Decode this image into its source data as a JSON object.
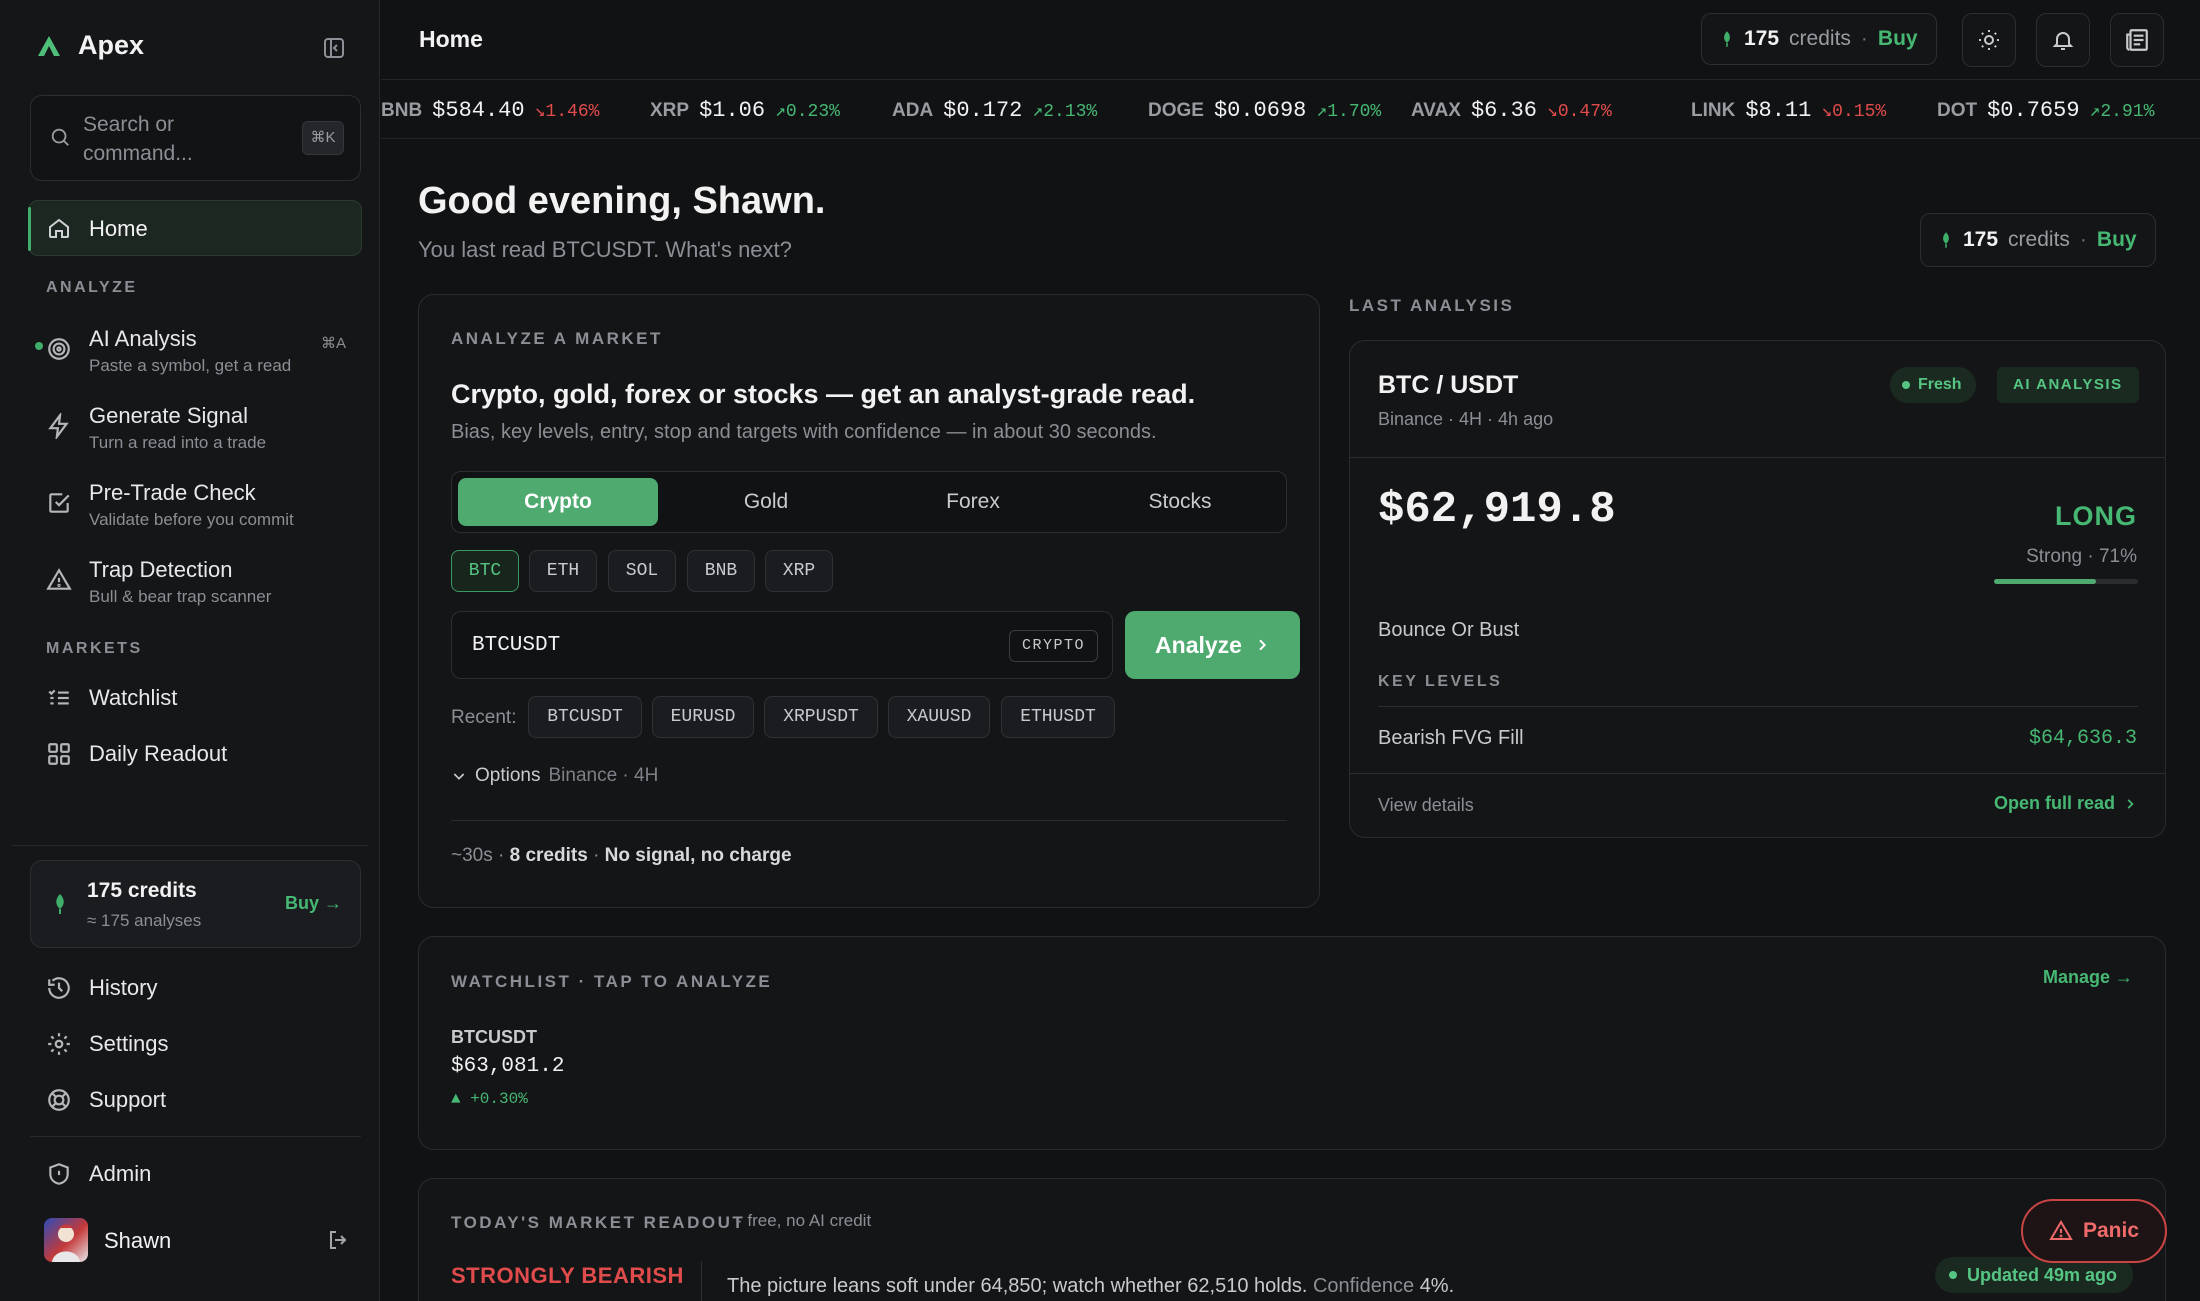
{
  "app": {
    "name": "Apex"
  },
  "search": {
    "placeholder": "Search or command...",
    "shortcut": "⌘K"
  },
  "sidebar": {
    "home_label": "Home",
    "analyze_section": "ANALYZE",
    "analyze_items": [
      {
        "title": "AI Analysis",
        "sub": "Paste a symbol, get a read",
        "shortcut": "⌘A"
      },
      {
        "title": "Generate Signal",
        "sub": "Turn a read into a trade"
      },
      {
        "title": "Pre-Trade Check",
        "sub": "Validate before you commit"
      },
      {
        "title": "Trap Detection",
        "sub": "Bull & bear trap scanner"
      }
    ],
    "markets_section": "MARKETS",
    "market_items": [
      "Watchlist",
      "Daily Readout"
    ],
    "credits": {
      "title": "175 credits",
      "sub": "≈ 175 analyses",
      "buy": "Buy →"
    },
    "footer_items": [
      "History",
      "Settings",
      "Support"
    ],
    "admin": "Admin",
    "user": {
      "name": "Shawn"
    }
  },
  "topbar": {
    "title": "Home",
    "credits": {
      "count": "175",
      "word": "credits",
      "sep": "·",
      "buy": "Buy"
    }
  },
  "ticker": [
    {
      "sym": "BNB",
      "price": "$584.40",
      "chg": "↘1.46%",
      "dir": "down"
    },
    {
      "sym": "XRP",
      "price": "$1.06",
      "chg": "↗0.23%",
      "dir": "up"
    },
    {
      "sym": "ADA",
      "price": "$0.172",
      "chg": "↗2.13%",
      "dir": "up"
    },
    {
      "sym": "DOGE",
      "price": "$0.0698",
      "chg": "↗1.70%",
      "dir": "up"
    },
    {
      "sym": "AVAX",
      "price": "$6.36",
      "chg": "↘0.47%",
      "dir": "down"
    },
    {
      "sym": "LINK",
      "price": "$8.11",
      "chg": "↘0.15%",
      "dir": "down"
    },
    {
      "sym": "DOT",
      "price": "$0.7659",
      "chg": "↗2.91%",
      "dir": "up"
    }
  ],
  "greeting": {
    "title": "Good evening, Shawn.",
    "sub": "You last read BTCUSDT. What's next?"
  },
  "analyze": {
    "label": "ANALYZE A MARKET",
    "headline": "Crypto, gold, forex or stocks — get an analyst-grade read.",
    "desc": "Bias, key levels, entry, stop and targets with confidence — in about 30 seconds.",
    "tabs": [
      "Crypto",
      "Gold",
      "Forex",
      "Stocks"
    ],
    "quick": [
      "BTC",
      "ETH",
      "SOL",
      "BNB",
      "XRP"
    ],
    "input_value": "BTCUSDT",
    "input_tag": "CRYPTO",
    "button": "Analyze",
    "recent_label": "Recent:",
    "recent": [
      "BTCUSDT",
      "EURUSD",
      "XRPUSDT",
      "XAUUSD",
      "ETHUSDT"
    ],
    "options_label": "Options",
    "options_meta": "Binance · 4H",
    "foot_time": "~30s ·",
    "foot_credits": "8 credits",
    "foot_sep": "·",
    "foot_charge": "No signal, no charge"
  },
  "last_analysis": {
    "label": "LAST ANALYSIS",
    "pair": "BTC / USDT",
    "meta": "Binance · 4H · 4h ago",
    "fresh": "Fresh",
    "badge": "AI ANALYSIS",
    "price": "$62,919.8",
    "direction": "LONG",
    "strength": "Strong · 71%",
    "strength_value": 0.71,
    "setup": "Bounce Or Bust",
    "key_levels_label": "KEY LEVELS",
    "level_name": "Bearish FVG Fill",
    "level_value": "$64,636.3",
    "view": "View details",
    "open": "Open full read"
  },
  "watchlist": {
    "label": "WATCHLIST · TAP TO ANALYZE",
    "manage": "Manage →",
    "symbol": "BTCUSDT",
    "price": "$63,081.2",
    "change": "▲ +0.30%"
  },
  "readout": {
    "label": "TODAY'S MARKET READOUT",
    "sub": "· free, no AI credit",
    "bias": "STRONGLY BEARISH",
    "text": "The picture leans soft under 64,850; watch whether 62,510 holds.",
    "conf_label": "Confidence",
    "conf_value": "4%.",
    "updated": "Updated 49m ago"
  },
  "panic": {
    "label": "Panic"
  },
  "colors": {
    "accent": "#4faa6f",
    "up": "#46b873",
    "down": "#e04b4b",
    "bg": "#111214"
  }
}
